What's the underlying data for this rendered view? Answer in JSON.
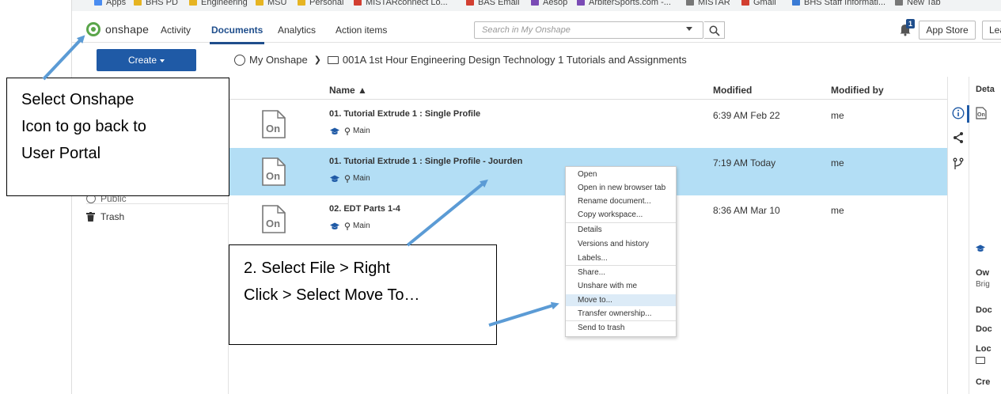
{
  "bookmarks": [
    {
      "label": "Apps",
      "color": "#4a8cf0"
    },
    {
      "label": "BHS PD",
      "color": "#e6b422"
    },
    {
      "label": "Engineering",
      "color": "#e6b422"
    },
    {
      "label": "MSU",
      "color": "#e6b422"
    },
    {
      "label": "Personal",
      "color": "#e6b422"
    },
    {
      "label": "MISTARconnect Lo...",
      "color": "#d23f31"
    },
    {
      "label": "BAS Email",
      "color": "#d23f31"
    },
    {
      "label": "Aesop",
      "color": "#7a4bb5"
    },
    {
      "label": "ArbiterSports.com -...",
      "color": "#7a4bb5"
    },
    {
      "label": "MISTAR",
      "color": "#777777"
    },
    {
      "label": "Gmail",
      "color": "#d23f31"
    },
    {
      "label": "BHS Staff Informati...",
      "color": "#3a7bd5"
    },
    {
      "label": "New Tab",
      "color": "#777777"
    }
  ],
  "topnav": {
    "logo_text": "onshape",
    "tabs": [
      "Activity",
      "Documents",
      "Analytics",
      "Action items"
    ],
    "active_tab": "Documents",
    "search_placeholder": "Search in My Onshape",
    "notification_count": "1",
    "app_store_label": "App Store",
    "learn_label": "Learn"
  },
  "create_button": {
    "label": "Create"
  },
  "breadcrumb": {
    "root": "My Onshape",
    "folder": "001A 1st Hour Engineering Design Technology 1 Tutorials and Assignments"
  },
  "sidebar": {
    "items": [
      {
        "label": "Public"
      },
      {
        "label": "Trash"
      }
    ]
  },
  "table": {
    "headers": {
      "name": "Name ▲",
      "modified": "Modified",
      "modified_by": "Modified by"
    },
    "rows": [
      {
        "name": "01. Tutorial Extrude 1 : Single Profile",
        "branch": "Main",
        "modified": "6:39 AM Feb 22",
        "modified_by": "me",
        "selected": false
      },
      {
        "name": "01. Tutorial Extrude 1 : Single Profile - Jourden",
        "branch": "Main",
        "modified": "7:19 AM Today",
        "modified_by": "me",
        "selected": true
      },
      {
        "name": "02. EDT Parts 1-4",
        "branch": "Main",
        "modified": "8:36 AM Mar 10",
        "modified_by": "me",
        "selected": false
      }
    ]
  },
  "details_panel": {
    "title": "Deta",
    "labels": [
      "Ow",
      "Brig",
      "Doc",
      "Doc",
      "Loc",
      "Cre"
    ]
  },
  "context_menu": {
    "items": [
      "Open",
      "Open in new browser tab",
      "Rename document...",
      "Copy workspace...",
      "Details",
      "Versions and history",
      "Labels...",
      "Share...",
      "Unshare with me",
      "Move to...",
      "Transfer ownership...",
      "Send to trash"
    ],
    "highlighted": "Move to..."
  },
  "callouts": {
    "step1": [
      "Select Onshape",
      "Icon to go back to",
      "User Portal"
    ],
    "step2": [
      "2. Select File > Right",
      "Click > Select Move To…"
    ]
  },
  "colors": {
    "accent": "#1f5aa6",
    "selected_row": "#b3def5",
    "arrow": "#5b9bd5",
    "logo_green": "#5aa54a"
  }
}
